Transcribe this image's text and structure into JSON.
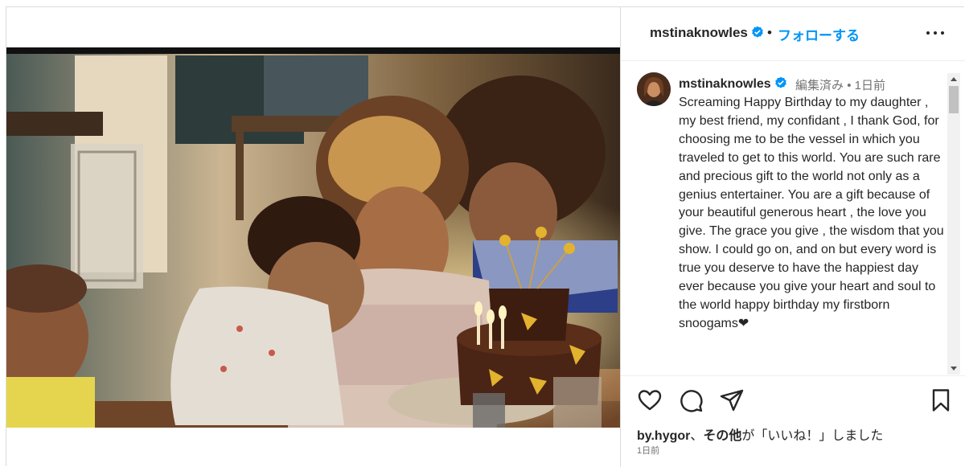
{
  "header": {
    "username": "mstinaknowles",
    "separator": "•",
    "follow_label": "フォローする",
    "more_icon": "more-horizontal-icon"
  },
  "caption": {
    "username": "mstinaknowles",
    "edited_label": "編集済み",
    "separator": "•",
    "time_ago": "1日前",
    "text": "Screaming Happy Birthday to my daughter , my best friend, my confidant , I thank God, for choosing me to be the vessel in which you traveled to get to this world. You are such rare and precious gift to the world not only as a genius entertainer. You are a gift because of your beautiful generous heart , the love you give. The grace you give , the wisdom that you show. I could go on, and on but every word is true you deserve to have the happiest day ever because you give your heart and soul to the world happy birthday my firstborn snoogams❤"
  },
  "actions": {
    "like_icon": "heart-icon",
    "comment_icon": "comment-icon",
    "share_icon": "paper-plane-icon",
    "save_icon": "bookmark-icon"
  },
  "likes": {
    "user": "by.hygor",
    "connector": "、",
    "others": "その他",
    "suffix": "が「いいね！」しました"
  },
  "post_date": "1日前",
  "colors": {
    "accent": "#0095f6",
    "verified": "#0095f6",
    "text": "#262626",
    "secondary": "#737373",
    "border": "#dbdbdb"
  }
}
